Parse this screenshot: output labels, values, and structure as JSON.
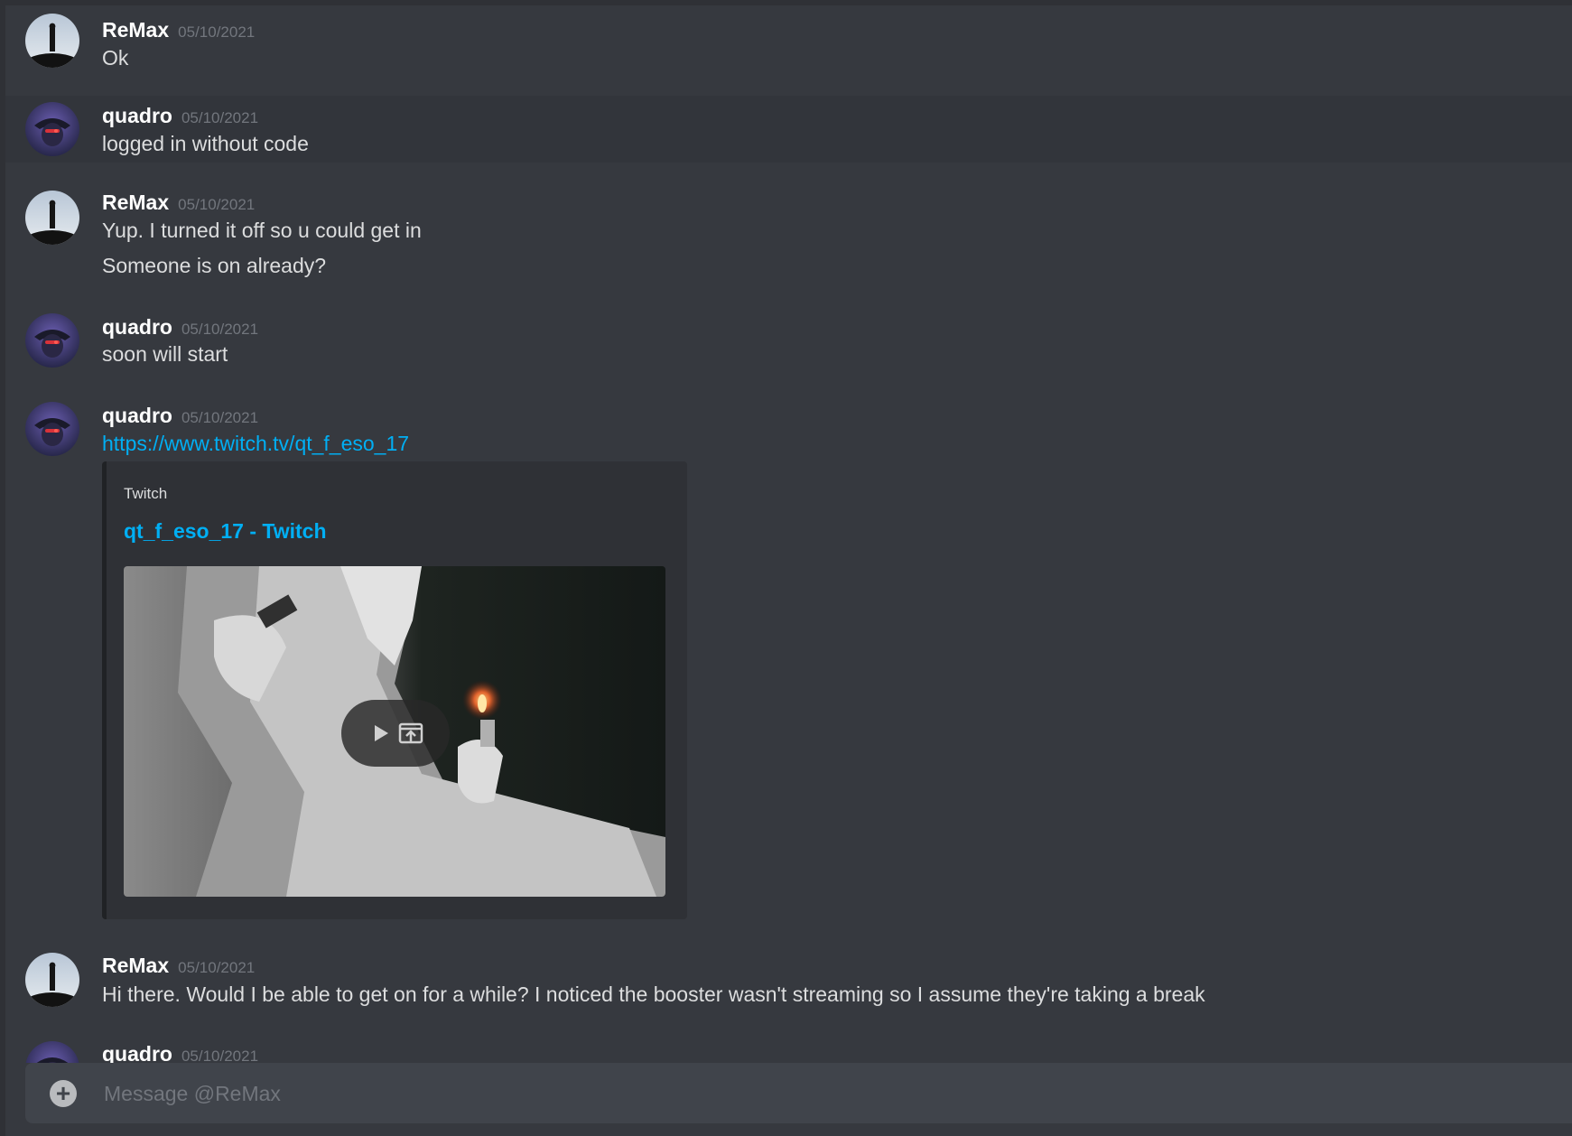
{
  "channel": {
    "recipient": "ReMax"
  },
  "messages": [
    {
      "author": "ReMax",
      "timestamp": "05/10/2021",
      "lines": [
        "Ok"
      ]
    },
    {
      "author": "quadro",
      "timestamp": "05/10/2021",
      "lines": [
        "logged in without code"
      ]
    },
    {
      "author": "ReMax",
      "timestamp": "05/10/2021",
      "lines": [
        "Yup. I turned it off so u could get in",
        "Someone is on already?"
      ]
    },
    {
      "author": "quadro",
      "timestamp": "05/10/2021",
      "lines": [
        "soon will start"
      ]
    },
    {
      "author": "quadro",
      "timestamp": "05/10/2021",
      "link": "https://www.twitch.tv/qt_f_eso_17",
      "embed": {
        "provider": "Twitch",
        "title": "qt_f_eso_17 - Twitch",
        "controls": [
          "play-icon",
          "external-link-icon"
        ]
      }
    },
    {
      "author": "ReMax",
      "timestamp": "05/10/2021",
      "lines": [
        "Hi there. Would I be able to get on for a while? I noticed the booster wasn't streaming so I assume they're taking a break"
      ]
    },
    {
      "author": "quadro",
      "timestamp": "05/10/2021",
      "lines": []
    }
  ],
  "composer": {
    "placeholder": "Message @ReMax",
    "attach_icon": "plus-circle-icon"
  },
  "colors": {
    "background": "#36393f",
    "username": "#ffffff",
    "text": "#dcddde",
    "timestamp": "#72767d",
    "link": "#00aff4",
    "embed_bg": "#2f3136"
  }
}
